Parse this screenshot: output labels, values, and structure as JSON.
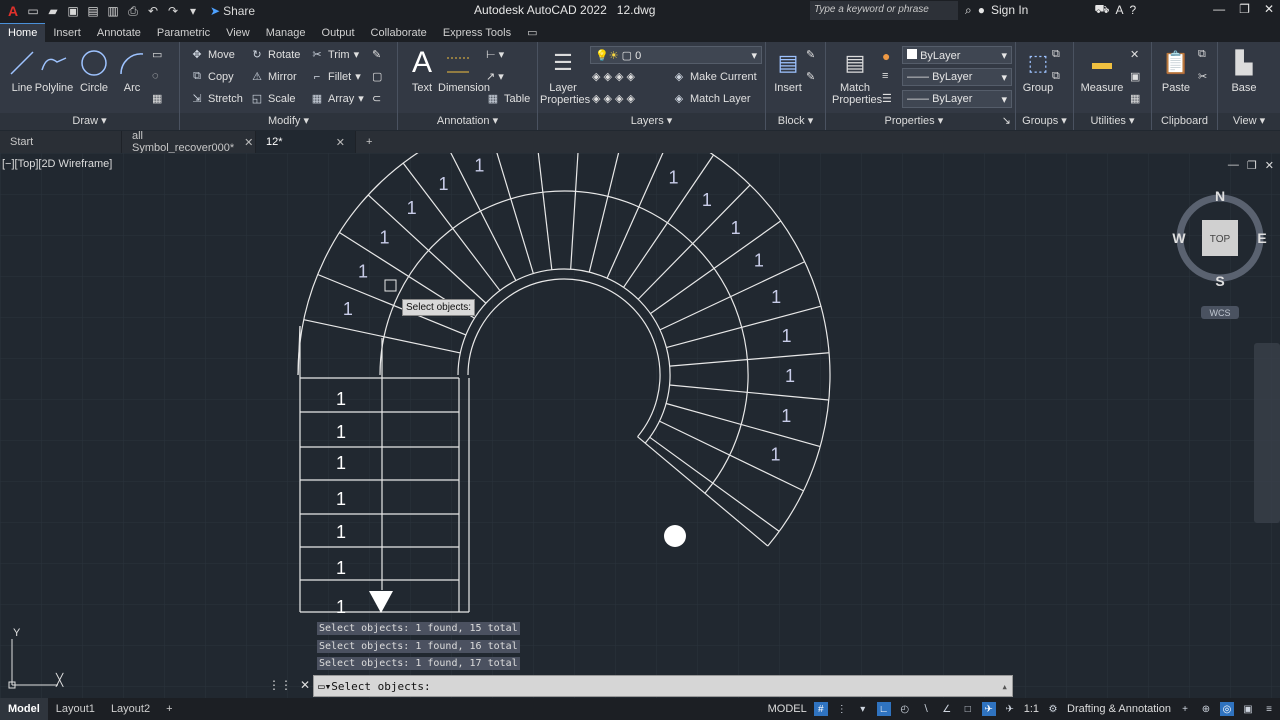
{
  "app": {
    "title": "Autodesk AutoCAD 2022",
    "filename": "12.dwg",
    "share_label": "Share",
    "search_placeholder": "Type a keyword or phrase",
    "signin_label": "Sign In"
  },
  "ribbon_tabs": [
    "Home",
    "Insert",
    "Annotate",
    "Parametric",
    "View",
    "Manage",
    "Output",
    "Collaborate",
    "Express Tools"
  ],
  "draw": {
    "title": "Draw",
    "line": "Line",
    "polyline": "Polyline",
    "circle": "Circle",
    "arc": "Arc"
  },
  "modify": {
    "title": "Modify",
    "move": "Move",
    "rotate": "Rotate",
    "trim": "Trim",
    "copy": "Copy",
    "mirror": "Mirror",
    "fillet": "Fillet",
    "stretch": "Stretch",
    "scale": "Scale",
    "array": "Array"
  },
  "annotation": {
    "title": "Annotation",
    "text": "Text",
    "dimension": "Dimension",
    "table": "Table"
  },
  "layers": {
    "title": "Layers",
    "layer_properties": "Layer Properties",
    "current_layer": "0",
    "make_current": "Make Current",
    "match_layer": "Match Layer"
  },
  "block": {
    "title": "Block",
    "insert": "Insert"
  },
  "properties": {
    "title": "Properties",
    "match_properties": "Match Properties",
    "color": "ByLayer",
    "linetype": "ByLayer",
    "lineweight": "ByLayer"
  },
  "groups": {
    "title": "Groups",
    "group": "Group"
  },
  "utilities": {
    "title": "Utilities",
    "measure": "Measure"
  },
  "clipboard": {
    "title": "Clipboard",
    "paste": "Paste"
  },
  "view": {
    "title": "View",
    "base": "Base"
  },
  "doc_tabs": {
    "start": "Start",
    "tab1": "all Symbol_recover000*",
    "tab2": "12*"
  },
  "viewport": {
    "label": "[−][Top][2D Wireframe]",
    "tooltip": "Select objects:",
    "step_label": "1",
    "viewcube": {
      "n": "N",
      "s": "S",
      "e": "E",
      "w": "W",
      "top": "TOP",
      "wcs": "WCS"
    },
    "ucs_y": "Y"
  },
  "command_history": [
    "Select objects: 1 found, 15 total",
    "Select objects: 1 found, 16 total",
    "Select objects: 1 found, 17 total"
  ],
  "command_prompt": "Select objects:",
  "status_tabs": [
    "Model",
    "Layout1",
    "Layout2"
  ],
  "status": {
    "model": "MODEL",
    "scale": "1:1",
    "workspace": "Drafting & Annotation"
  }
}
